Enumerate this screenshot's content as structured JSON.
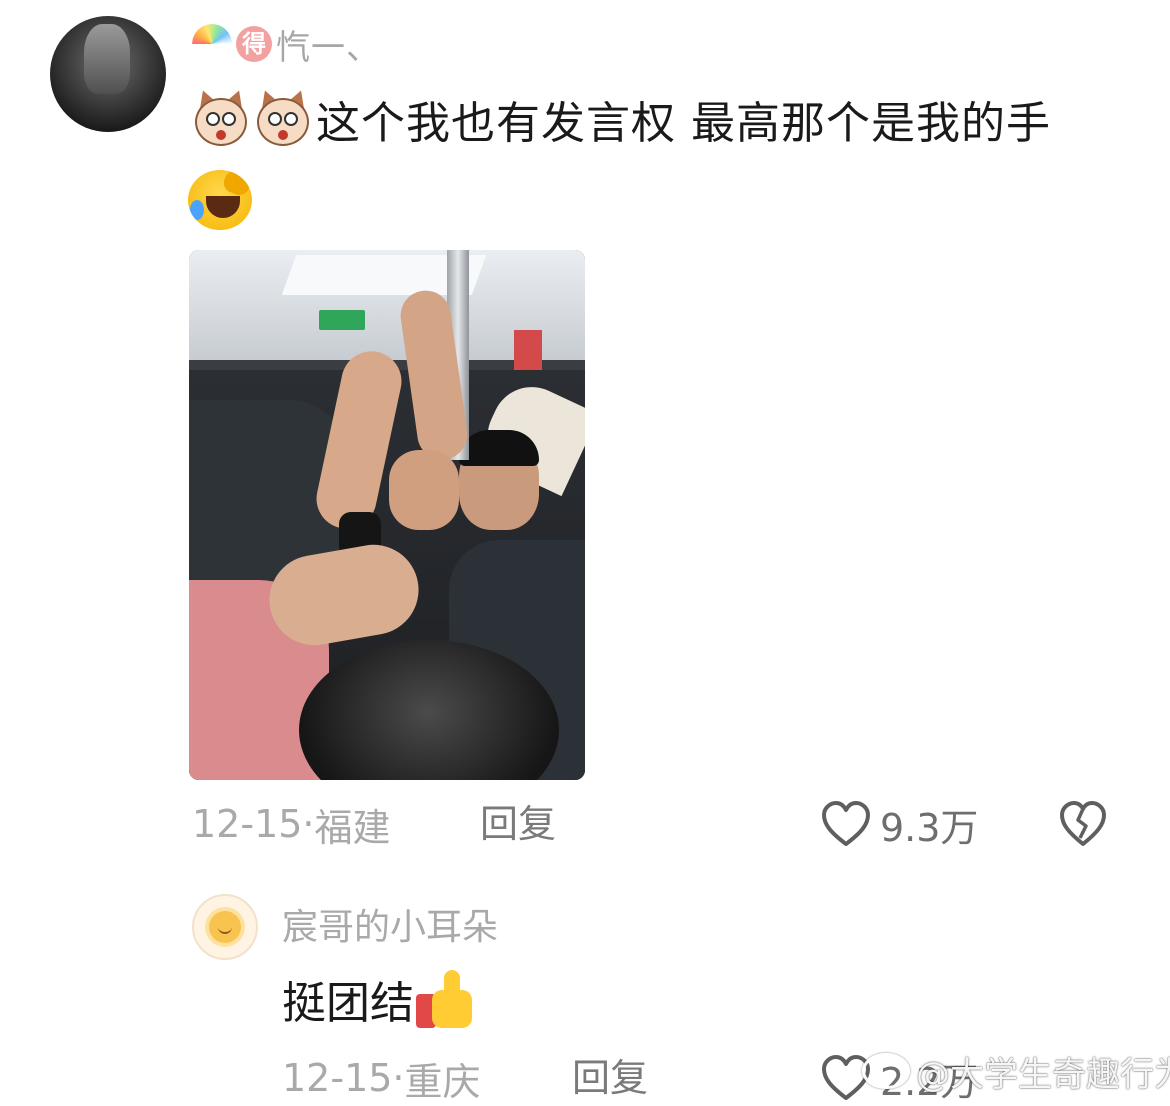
{
  "comment1": {
    "username": "忾一、",
    "badge_text": "得",
    "text": "这个我也有发言权  最高那个是我的手",
    "emoji_prefix": [
      "dog-emoji",
      "dog-emoji"
    ],
    "emoji_suffix": "laugh-crying-emoji",
    "image": "crowded-subway-photo",
    "date": "12-15",
    "location": "福建",
    "separator": " · ",
    "reply_label": "回复",
    "likes": "9.3万"
  },
  "comment2": {
    "username": "宸哥的小耳朵",
    "text": "挺团结",
    "emoji_suffix": "thumbs-up-emoji",
    "date": "12-15",
    "location": "重庆",
    "separator": " · ",
    "reply_label": "回复",
    "likes": "2.2万"
  },
  "watermark": {
    "text": "@大学生奇趣行为"
  },
  "colors": {
    "meta_gray": "#a9a9a9",
    "text_dark": "#1a1a1a",
    "heart_stroke": "#5f5f5f"
  }
}
